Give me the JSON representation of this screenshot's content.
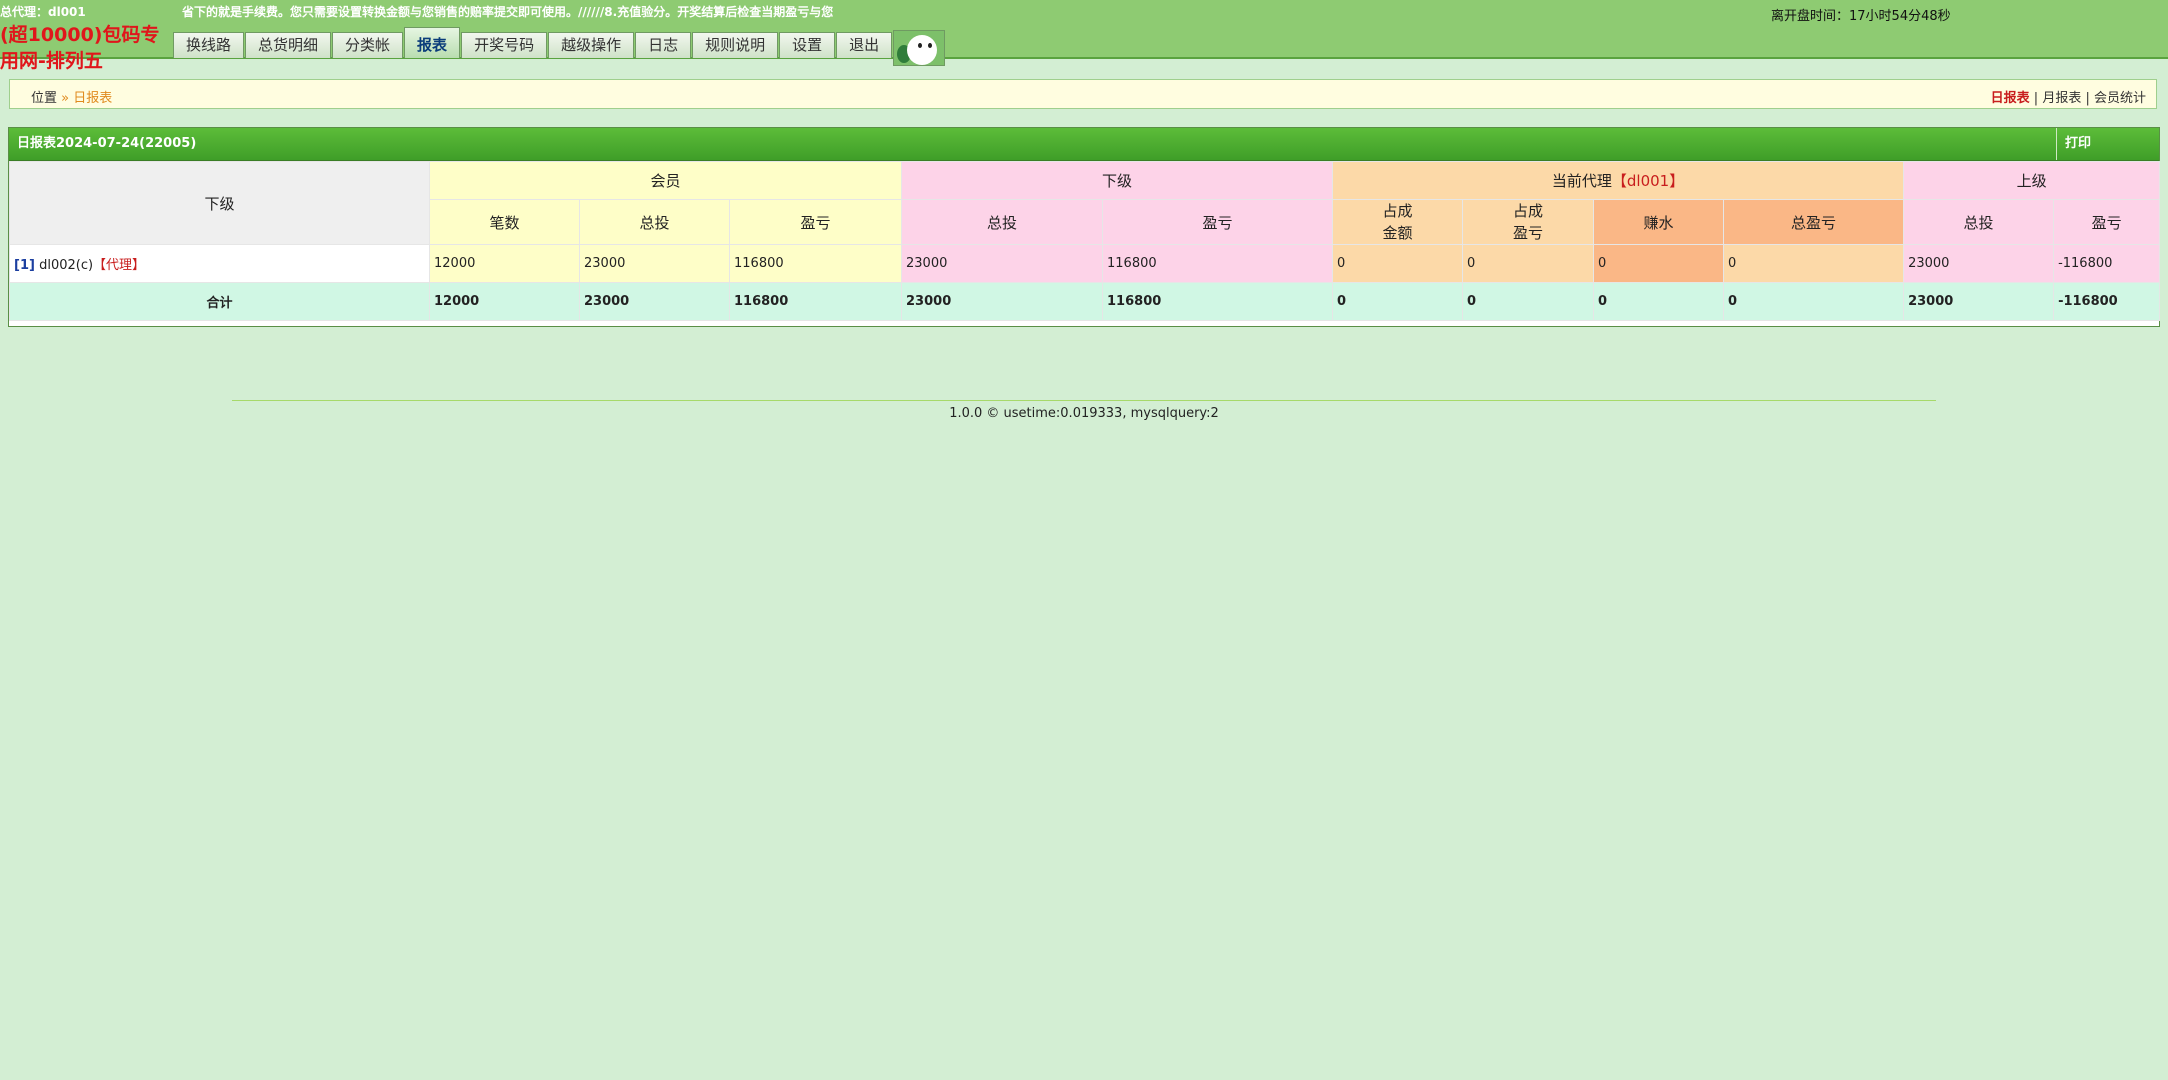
{
  "header": {
    "agent_label": "总代理：dl001",
    "notice": "省下的就是手续费。您只需要设置转换金额与您销售的赔率提交即可使用。//////8.充值验分。开奖结算后检查当期盈亏与您",
    "countdown": "离开盘时间：17小时54分48秒",
    "site_name": "(超10000)包码专用网-排列五",
    "nav": [
      "换线路",
      "总货明细",
      "分类帐",
      "报表",
      "开奖号码",
      "越级操作",
      "日志",
      "规则说明",
      "设置",
      "退出"
    ],
    "active_nav": "报表"
  },
  "breadcrumb": {
    "location": "位置",
    "separator": "»",
    "current": "日报表"
  },
  "report_links": [
    "日报表",
    "月报表",
    "会员统计"
  ],
  "report": {
    "title": "日报表2024-07-24(22005)",
    "print": "打印",
    "groups": {
      "level": "下级",
      "member": "会员",
      "sub": "下级",
      "agent_prefix": "当前代理",
      "agent_name": "【dl001】",
      "upper": "上级"
    },
    "columns": {
      "member_count": "笔数",
      "member_bet": "总投",
      "member_pl": "盈亏",
      "sub_bet": "总投",
      "sub_pl": "盈亏",
      "agent_share_amount": "占成\n金额",
      "agent_share_pl": "占成\n盈亏",
      "agent_rebate": "赚水",
      "agent_total_pl": "总盈亏",
      "upper_bet": "总投",
      "upper_pl": "盈亏"
    },
    "rows": [
      {
        "index": "[1]",
        "name": "dl002(c)",
        "tag": "【代理】",
        "member_count": "12000",
        "member_bet": "23000",
        "member_pl": "116800",
        "sub_bet": "23000",
        "sub_pl": "116800",
        "agent_share_amount": "0",
        "agent_share_pl": "0",
        "agent_rebate": "0",
        "agent_total_pl": "0",
        "upper_bet": "23000",
        "upper_pl": "-116800"
      }
    ],
    "total": {
      "label": "合计",
      "member_count": "12000",
      "member_bet": "23000",
      "member_pl": "116800",
      "sub_bet": "23000",
      "sub_pl": "116800",
      "agent_share_amount": "0",
      "agent_share_pl": "0",
      "agent_rebate": "0",
      "agent_total_pl": "0",
      "upper_bet": "23000",
      "upper_pl": "-116800"
    }
  },
  "footer": "1.0.0  © usetime:0.019333, mysqlquery:2"
}
